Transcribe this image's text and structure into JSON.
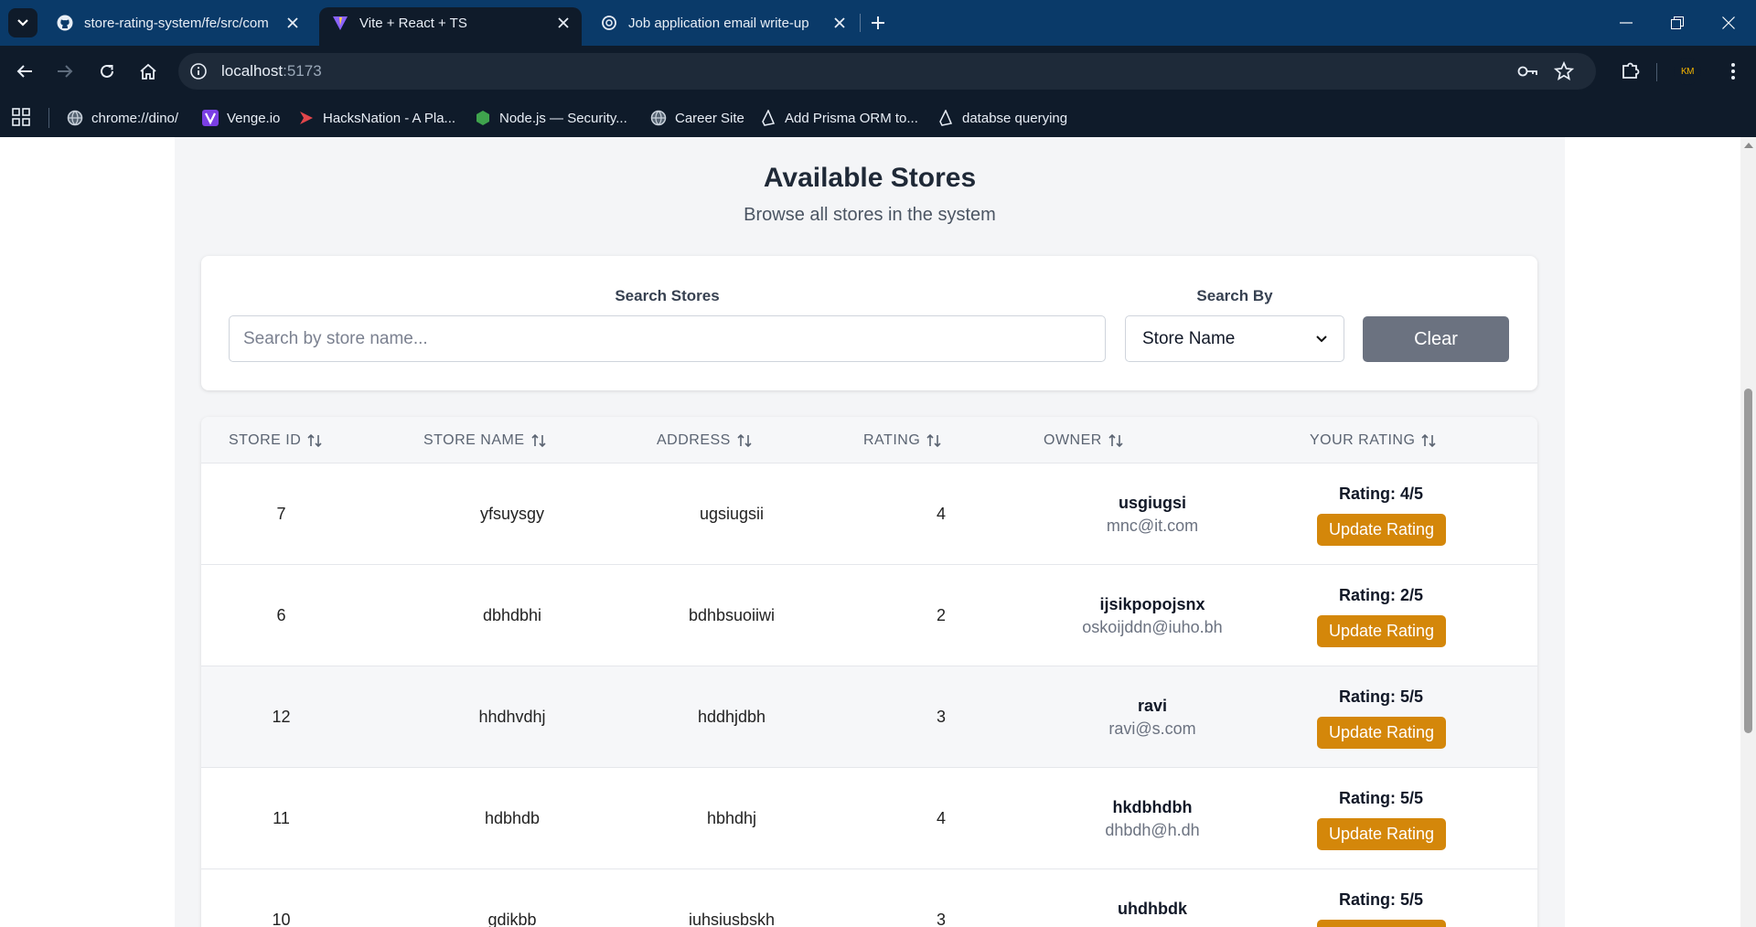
{
  "browser": {
    "tabs": [
      {
        "title": "store-rating-system/fe/src/com",
        "favicon": "github-icon"
      },
      {
        "title": "Vite + React + TS",
        "favicon": "vite-icon",
        "active": true
      },
      {
        "title": "Job application email write-up",
        "favicon": "chatgpt-icon"
      }
    ],
    "url_host": "localhost",
    "url_port": ":5173",
    "profile_initials": "KM",
    "bookmarks": [
      {
        "label": "chrome://dino/",
        "icon": "globe-icon"
      },
      {
        "label": "Venge.io",
        "icon": "venge-icon"
      },
      {
        "label": "HacksNation - A Pla...",
        "icon": "hacksnation-icon"
      },
      {
        "label": "Node.js — Security...",
        "icon": "nodejs-icon"
      },
      {
        "label": "Career Site",
        "icon": "globe-icon"
      },
      {
        "label": "Add Prisma ORM to...",
        "icon": "prisma-icon"
      },
      {
        "label": "databse querying",
        "icon": "prisma-icon"
      }
    ]
  },
  "page": {
    "title": "Available Stores",
    "subtitle": "Browse all stores in the system"
  },
  "search": {
    "search_label": "Search Stores",
    "placeholder": "Search by store name...",
    "value": "",
    "search_by_label": "Search By",
    "search_by_value": "Store Name",
    "clear_label": "Clear"
  },
  "table": {
    "columns": [
      "STORE ID",
      "STORE NAME",
      "ADDRESS",
      "RATING",
      "OWNER",
      "YOUR RATING"
    ],
    "update_label": "Update Rating",
    "rows": [
      {
        "id": "7",
        "name": "yfsuysgy",
        "address": "ugsiugsii",
        "rating": "4",
        "owner_name": "usgiugsi",
        "owner_email": "mnc@it.com",
        "your_rating": "Rating: 4/5"
      },
      {
        "id": "6",
        "name": "dbhdbhi",
        "address": "bdhbsuoiiwi",
        "rating": "2",
        "owner_name": "ijsikpopojsnx",
        "owner_email": "oskoijddn@iuho.bh",
        "your_rating": "Rating: 2/5"
      },
      {
        "id": "12",
        "name": "hhdhvdhj",
        "address": "hddhjdbh",
        "rating": "3",
        "owner_name": "ravi",
        "owner_email": "ravi@s.com",
        "your_rating": "Rating: 5/5"
      },
      {
        "id": "11",
        "name": "hdbhdb",
        "address": "hbhdhj",
        "rating": "4",
        "owner_name": "hkdbhdbh",
        "owner_email": "dhbdh@h.dh",
        "your_rating": "Rating: 5/5"
      },
      {
        "id": "10",
        "name": "gdikbb",
        "address": "iuhsiusbskh",
        "rating": "3",
        "owner_name": "uhdhbdk",
        "owner_email": "",
        "your_rating": "Rating: 5/5"
      }
    ]
  },
  "colors": {
    "update_button": "#d4870a",
    "clear_button": "#6b7280",
    "tabstrip": "#0a3a69",
    "toolbar": "#0f1b2a"
  }
}
